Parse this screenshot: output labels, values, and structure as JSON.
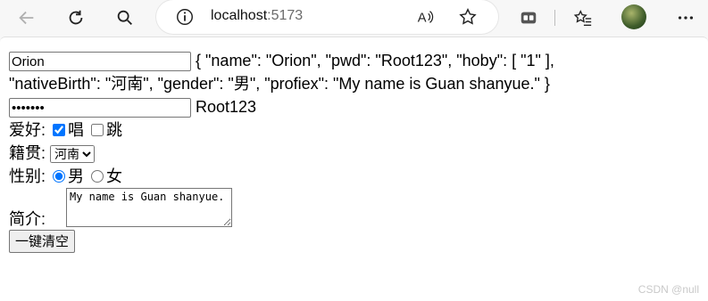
{
  "browser": {
    "url_host": "localhost",
    "url_port": ":5173"
  },
  "form": {
    "name_value": "Orion",
    "json_line1": "{ \"name\": \"Orion\", \"pwd\": \"Root123\", \"hoby\": [ \"1\" ],",
    "json_line2": "\"nativeBirth\": \"河南\", \"gender\": \"男\", \"profiex\": \"My name is Guan shanyue.\" }",
    "pwd_value": "Root123",
    "pwd_display": "Root123",
    "hobby_label": "爱好:",
    "hobby_sing": "唱",
    "hobby_jump": "跳",
    "native_label": "籍贯:",
    "native_selected": "河南",
    "gender_label": "性别:",
    "gender_male": "男",
    "gender_female": "女",
    "intro_label": "简介:",
    "intro_value": "My name is Guan shanyue.",
    "clear_button": "一键清空"
  },
  "watermark": "CSDN @null"
}
